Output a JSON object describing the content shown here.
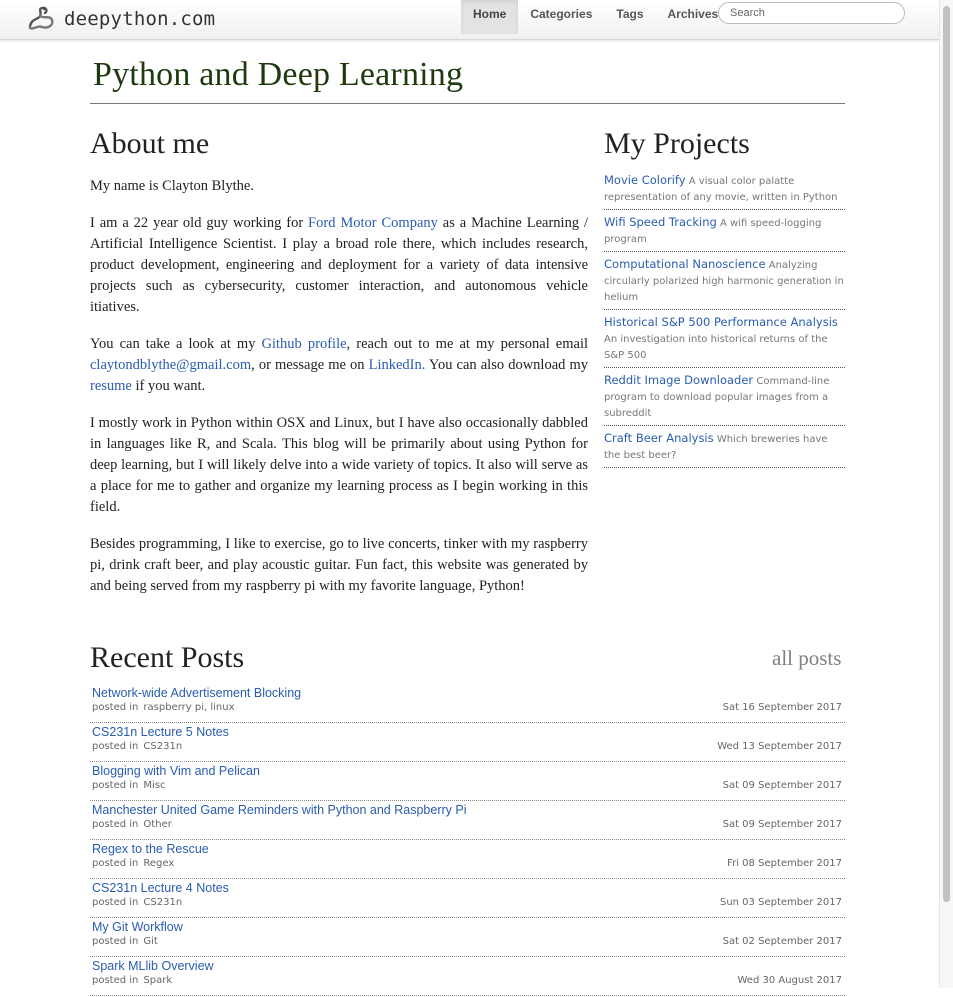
{
  "navbar": {
    "brand": "deepython.com",
    "brand_icon": "python-snake-icon",
    "links": [
      {
        "label": "Home",
        "active": true
      },
      {
        "label": "Categories",
        "active": false
      },
      {
        "label": "Tags",
        "active": false
      },
      {
        "label": "Archives",
        "active": false
      }
    ],
    "search_placeholder": "Search"
  },
  "header": {
    "title": "Python and Deep Learning"
  },
  "about": {
    "heading": "About me",
    "p1": "My name is Clayton Blythe.",
    "p2": {
      "t1": "I am a 22 year old guy working for ",
      "link1": "Ford Motor Company",
      "t2": " as a Machine Learning / Artificial Intelligence Scientist. I play a broad role there, which includes research, product development, engineering and deployment for a variety of data intensive projects such as cybersecurity, customer interaction, and autonomous vehicle itiatives."
    },
    "p3": {
      "t1": "You can take a look at my ",
      "link1": "Github profile",
      "t2": ", reach out to me at my personal email ",
      "link2": "claytondblythe@gmail.com",
      "t3": ", or message me on ",
      "link3": "LinkedIn.",
      "t4": " You can also download my ",
      "link4": "resume",
      "t5": " if you want."
    },
    "p4": "I mostly work in Python within OSX and Linux, but I have also occasionally dabbled in languages like R, and Scala. This blog will be primarily about using Python for deep learning, but I will likely delve into a wide variety of topics. It also will serve as a place for me to gather and organize my learning process as I begin working in this field.",
    "p5": "Besides programming, I like to exercise, go to live concerts, tinker with my raspberry pi, drink craft beer, and play acoustic guitar. Fun fact, this website was generated by and being served from my raspberry pi with my favorite language, Python!"
  },
  "projects": {
    "heading": "My Projects",
    "items": [
      {
        "title": "Movie Colorify",
        "desc": "A visual color palatte representation of any movie, written in Python"
      },
      {
        "title": "Wifi Speed Tracking",
        "desc": "A wifi speed-logging program"
      },
      {
        "title": "Computational Nanoscience",
        "desc": "Analyzing circularly polarized high harmonic generation in helium"
      },
      {
        "title": "Historical S&P 500 Performance Analysis",
        "desc": "An investigation into historical returns of the S&P 500"
      },
      {
        "title": "Reddit Image Downloader",
        "desc": "Command-line program to download popular images from a subreddit"
      },
      {
        "title": "Craft Beer Analysis",
        "desc": "Which breweries have the best beer?"
      }
    ]
  },
  "recent": {
    "heading": "Recent Posts",
    "all_posts": "all posts",
    "posted_in": "posted in",
    "posts": [
      {
        "title": "Network-wide Advertisement Blocking",
        "category": "raspberry pi, linux",
        "date": "Sat 16 September 2017"
      },
      {
        "title": "CS231n Lecture 5 Notes",
        "category": "CS231n",
        "date": "Wed 13 September 2017"
      },
      {
        "title": "Blogging with Vim and Pelican",
        "category": "Misc",
        "date": "Sat 09 September 2017"
      },
      {
        "title": "Manchester United Game Reminders with Python and Raspberry Pi",
        "category": "Other",
        "date": "Sat 09 September 2017"
      },
      {
        "title": "Regex to the Rescue",
        "category": "Regex",
        "date": "Fri 08 September 2017"
      },
      {
        "title": "CS231n Lecture 4 Notes",
        "category": "CS231n",
        "date": "Sun 03 September 2017"
      },
      {
        "title": "My Git Workflow",
        "category": "Git",
        "date": "Sat 02 September 2017"
      },
      {
        "title": "Spark MLlib Overview",
        "category": "Spark",
        "date": "Wed 30 August 2017"
      }
    ]
  }
}
